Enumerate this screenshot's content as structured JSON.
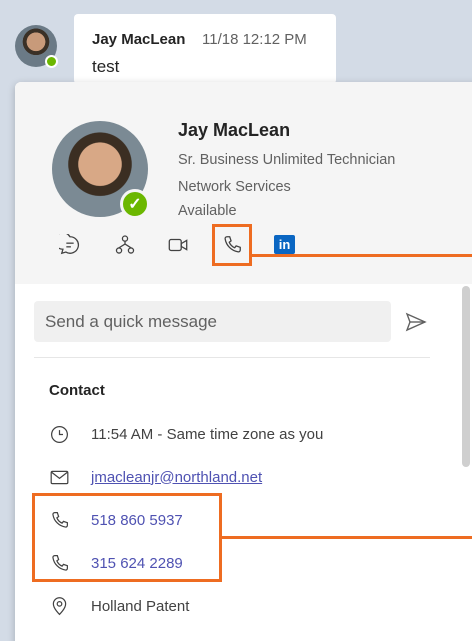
{
  "chat": {
    "author": "Jay MacLean",
    "timestamp": "11/18 12:12 PM",
    "message": "test"
  },
  "card": {
    "name": "Jay MacLean",
    "title": "Sr. Business Unlimited Technician",
    "department": "Network Services",
    "status": "Available",
    "actions": [
      {
        "name": "chat-icon"
      },
      {
        "name": "org-chart-icon"
      },
      {
        "name": "video-call-icon"
      },
      {
        "name": "phone-call-icon"
      },
      {
        "name": "linkedin-icon",
        "label": "in"
      }
    ],
    "quick_message": {
      "placeholder": "Send a quick message",
      "value": ""
    },
    "contact": {
      "heading": "Contact",
      "local_time": "11:54 AM - Same time zone as you",
      "email": "jmacleanjr@northland.net",
      "phones": [
        "518 860 5937",
        "315 624 2289"
      ],
      "location": "Holland Patent"
    }
  },
  "colors": {
    "highlight": "#ee6c21",
    "link": "#4f52b2",
    "presence": "#6bb700",
    "background": "#d3dbe6"
  }
}
